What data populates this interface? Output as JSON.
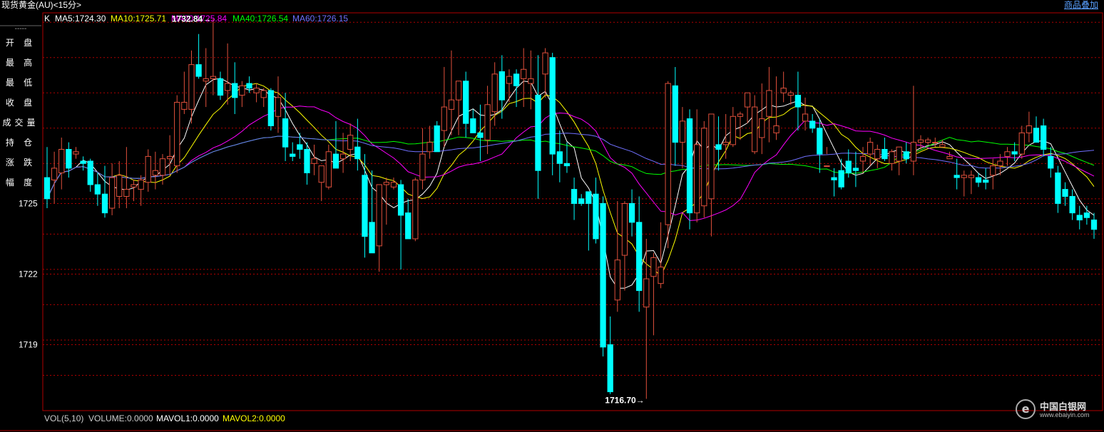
{
  "window": {
    "title": "现货黄金(AU)<15分>",
    "overlay_label": "商品叠加"
  },
  "sidebar": {
    "dash": "-----",
    "items": [
      "开 盘",
      "最 高",
      "最 低",
      "收 盘",
      "成交量",
      "持 仓",
      "涨 跌",
      "幅 度"
    ]
  },
  "logo": {
    "name": "中国白银网",
    "url": "www.ebaiyin.com"
  },
  "colors": {
    "up": "#e0503c",
    "down": "#00ffff",
    "ma5": "#ffffff",
    "ma10": "#ffff00",
    "ma20": "#ff00ff",
    "ma40": "#00ff00",
    "ma60": "#7070ff",
    "grid": "#b00000"
  },
  "legend": {
    "prefix": "K",
    "ma5": "MA5:1724.30",
    "ma10": "MA10:1725.71",
    "ma20": "MA20:1725.84",
    "ma40": "MA40:1726.54",
    "ma60": "MA60:1726.15"
  },
  "vol_legend": {
    "prefix": "VOL(5,10)",
    "volume": "VOLUME:0.0000",
    "mavol1": "MAVOL1:0.0000",
    "mavol2": "MAVOL2:0.0000"
  },
  "chart_data": {
    "type": "candlestick",
    "y_ticks": [
      1725,
      1722,
      1719
    ],
    "ylim": [
      1716.2,
      1733.1
    ],
    "grid": true,
    "annotations": {
      "high": "1732.84→",
      "low": "1716.70→"
    },
    "candles": [
      [
        1726.1,
        1727.4,
        1724.8,
        1725.2
      ],
      [
        1726.0,
        1727.2,
        1725.0,
        1726.5
      ],
      [
        1726.3,
        1727.8,
        1725.6,
        1727.3
      ],
      [
        1727.3,
        1727.6,
        1726.1,
        1726.5
      ],
      [
        1727.1,
        1727.4,
        1726.9,
        1727.2
      ],
      [
        1726.8,
        1727.0,
        1726.4,
        1726.7
      ],
      [
        1726.8,
        1726.9,
        1725.5,
        1725.8
      ],
      [
        1725.8,
        1726.3,
        1724.9,
        1725.4
      ],
      [
        1725.4,
        1726.6,
        1724.4,
        1724.6
      ],
      [
        1724.8,
        1726.7,
        1724.5,
        1726.1
      ],
      [
        1725.3,
        1726.8,
        1724.8,
        1726.2
      ],
      [
        1725.3,
        1727.4,
        1724.8,
        1725.6
      ],
      [
        1725.7,
        1726.0,
        1725.1,
        1725.8
      ],
      [
        1725.6,
        1726.2,
        1724.9,
        1726.0
      ],
      [
        1725.9,
        1727.3,
        1725.5,
        1727.0
      ],
      [
        1726.2,
        1727.2,
        1725.6,
        1726.4
      ],
      [
        1726.2,
        1727.1,
        1725.8,
        1726.9
      ],
      [
        1726.9,
        1727.9,
        1726.2,
        1727.0
      ],
      [
        1726.6,
        1729.6,
        1726.3,
        1729.3
      ],
      [
        1729.0,
        1730.6,
        1728.8,
        1729.3
      ],
      [
        1729.0,
        1731.5,
        1728.4,
        1730.9
      ],
      [
        1730.9,
        1732.2,
        1730.3,
        1730.4
      ],
      [
        1730.2,
        1731.6,
        1729.1,
        1730.3
      ],
      [
        1730.3,
        1732.84,
        1729.6,
        1730.4
      ],
      [
        1730.3,
        1730.6,
        1729.4,
        1729.6
      ],
      [
        1729.8,
        1731.8,
        1729.2,
        1730.1
      ],
      [
        1730.1,
        1731.0,
        1728.8,
        1729.5
      ],
      [
        1729.6,
        1730.2,
        1729.1,
        1730.0
      ],
      [
        1730.1,
        1730.4,
        1729.7,
        1729.9
      ],
      [
        1729.7,
        1730.1,
        1729.3,
        1729.9
      ],
      [
        1729.5,
        1729.9,
        1729.1,
        1729.8
      ],
      [
        1729.8,
        1729.9,
        1728.1,
        1728.3
      ],
      [
        1728.7,
        1730.4,
        1728.0,
        1729.5
      ],
      [
        1728.6,
        1729.7,
        1726.8,
        1727.4
      ],
      [
        1727.1,
        1727.6,
        1726.8,
        1727.0
      ],
      [
        1727.5,
        1728.0,
        1726.9,
        1727.3
      ],
      [
        1727.3,
        1727.6,
        1725.8,
        1726.3
      ],
      [
        1726.7,
        1727.5,
        1726.2,
        1726.9
      ],
      [
        1725.9,
        1726.6,
        1725.1,
        1726.6
      ],
      [
        1725.7,
        1727.5,
        1725.6,
        1727.2
      ],
      [
        1727.1,
        1728.5,
        1726.8,
        1726.5
      ],
      [
        1726.9,
        1728.0,
        1726.3,
        1727.1
      ],
      [
        1727.3,
        1728.4,
        1726.8,
        1727.9
      ],
      [
        1727.4,
        1728.6,
        1726.4,
        1726.9
      ],
      [
        1726.2,
        1727.1,
        1722.7,
        1723.6
      ],
      [
        1724.2,
        1726.4,
        1723.1,
        1722.9
      ],
      [
        1723.2,
        1725.8,
        1722.1,
        1725.8
      ],
      [
        1725.8,
        1726.1,
        1724.1,
        1725.9
      ],
      [
        1725.7,
        1726.1,
        1725.6,
        1725.9
      ],
      [
        1725.8,
        1726.0,
        1722.2,
        1724.5
      ],
      [
        1724.6,
        1725.2,
        1723.5,
        1723.5
      ],
      [
        1723.5,
        1726.1,
        1723.4,
        1726.0
      ],
      [
        1726.0,
        1728.2,
        1725.6,
        1727.1
      ],
      [
        1727.2,
        1728.3,
        1726.9,
        1727.6
      ],
      [
        1728.3,
        1728.5,
        1727.3,
        1727.2
      ],
      [
        1728.1,
        1730.8,
        1727.4,
        1729.1
      ],
      [
        1729.0,
        1731.5,
        1727.9,
        1729.4
      ],
      [
        1729.4,
        1730.1,
        1727.9,
        1730.2
      ],
      [
        1730.2,
        1730.6,
        1727.8,
        1728.4
      ],
      [
        1728.6,
        1729.0,
        1728.2,
        1728.0
      ],
      [
        1728.0,
        1729.2,
        1726.8,
        1727.8
      ],
      [
        1727.7,
        1730.0,
        1727.1,
        1729.2
      ],
      [
        1728.9,
        1731.0,
        1728.3,
        1730.5
      ],
      [
        1730.6,
        1731.3,
        1728.6,
        1729.4
      ],
      [
        1730.1,
        1730.7,
        1729.3,
        1730.4
      ],
      [
        1730.5,
        1730.7,
        1729.1,
        1730.0
      ],
      [
        1730.3,
        1731.6,
        1729.1,
        1730.7
      ],
      [
        1730.1,
        1731.5,
        1729.0,
        1730.3
      ],
      [
        1729.6,
        1731.3,
        1725.2,
        1726.4
      ],
      [
        1730.5,
        1731.6,
        1729.5,
        1731.4
      ],
      [
        1731.2,
        1731.4,
        1726.2,
        1727.1
      ],
      [
        1727.2,
        1728.1,
        1725.9,
        1726.7
      ],
      [
        1726.7,
        1727.6,
        1726.3,
        1726.6
      ],
      [
        1725.6,
        1726.1,
        1724.3,
        1725.0
      ],
      [
        1725.2,
        1725.4,
        1724.9,
        1725.0
      ],
      [
        1725.5,
        1725.5,
        1723.0,
        1725.0
      ],
      [
        1725.4,
        1726.1,
        1723.3,
        1723.5
      ],
      [
        1725.0,
        1725.3,
        1718.5,
        1718.9
      ],
      [
        1719.0,
        1720.2,
        1716.9,
        1717.0
      ],
      [
        1720.9,
        1725.1,
        1720.4,
        1722.6
      ],
      [
        1722.8,
        1725.1,
        1721.3,
        1725.0
      ],
      [
        1725.0,
        1725.6,
        1723.6,
        1724.2
      ],
      [
        1724.2,
        1725.3,
        1720.4,
        1721.3
      ],
      [
        1720.6,
        1723.5,
        1716.7,
        1721.8
      ],
      [
        1721.9,
        1722.9,
        1719.4,
        1722.7
      ],
      [
        1721.6,
        1724.2,
        1721.4,
        1722.3
      ],
      [
        1724.1,
        1730.2,
        1723.1,
        1730.1
      ],
      [
        1730.0,
        1730.8,
        1726.6,
        1727.6
      ],
      [
        1727.6,
        1729.1,
        1726.5,
        1728.5
      ],
      [
        1728.6,
        1729.0,
        1723.9,
        1724.6
      ],
      [
        1724.6,
        1729.0,
        1724.2,
        1727.5
      ],
      [
        1724.9,
        1728.5,
        1724.4,
        1728.2
      ],
      [
        1725.2,
        1728.4,
        1723.6,
        1728.8
      ],
      [
        1727.5,
        1728.7,
        1726.4,
        1727.3
      ],
      [
        1727.5,
        1728.8,
        1726.9,
        1727.6
      ],
      [
        1727.5,
        1729.1,
        1727.4,
        1728.7
      ],
      [
        1728.7,
        1728.9,
        1727.7,
        1728.8
      ],
      [
        1729.1,
        1729.4,
        1728.4,
        1729.7
      ],
      [
        1727.2,
        1729.6,
        1727.1,
        1729.1
      ],
      [
        1727.8,
        1730.1,
        1727.1,
        1728.6
      ],
      [
        1728.7,
        1730.8,
        1727.6,
        1729.8
      ],
      [
        1728.0,
        1730.4,
        1727.7,
        1728.3
      ],
      [
        1729.7,
        1730.6,
        1729.3,
        1729.9
      ],
      [
        1729.6,
        1729.8,
        1729.2,
        1729.7
      ],
      [
        1729.6,
        1730.6,
        1728.1,
        1729.1
      ],
      [
        1728.5,
        1729.5,
        1728.1,
        1728.8
      ],
      [
        1728.5,
        1728.8,
        1728.0,
        1728.2
      ],
      [
        1728.2,
        1728.6,
        1726.3,
        1727.1
      ],
      [
        1726.6,
        1727.4,
        1727.1,
        1726.6
      ],
      [
        1726.1,
        1726.5,
        1725.3,
        1726.0
      ],
      [
        1726.4,
        1726.9,
        1725.6,
        1725.7
      ],
      [
        1726.8,
        1727.3,
        1726.1,
        1726.3
      ],
      [
        1726.5,
        1727.2,
        1725.7,
        1726.4
      ],
      [
        1726.8,
        1727.4,
        1726.3,
        1727.0
      ],
      [
        1727.1,
        1727.8,
        1726.6,
        1727.6
      ],
      [
        1726.9,
        1727.5,
        1726.5,
        1727.3
      ],
      [
        1727.3,
        1727.8,
        1726.8,
        1726.9
      ],
      [
        1726.7,
        1727.3,
        1726.4,
        1727.2
      ],
      [
        1726.8,
        1727.4,
        1726.2,
        1727.4
      ],
      [
        1727.2,
        1727.6,
        1726.7,
        1726.9
      ],
      [
        1726.8,
        1730.0,
        1726.2,
        1727.6
      ],
      [
        1727.6,
        1727.9,
        1727.3,
        1727.7
      ],
      [
        1727.6,
        1727.8,
        1727.5,
        1727.7
      ],
      [
        1727.6,
        1727.8,
        1727.4,
        1727.6
      ],
      [
        1727.4,
        1727.7,
        1727.4,
        1727.5
      ],
      [
        1726.9,
        1727.2,
        1727.0,
        1727.0
      ],
      [
        1726.2,
        1726.9,
        1725.6,
        1726.1
      ],
      [
        1726.1,
        1726.4,
        1725.3,
        1726.2
      ],
      [
        1726.1,
        1726.4,
        1725.4,
        1726.2
      ],
      [
        1726.1,
        1726.3,
        1725.7,
        1725.9
      ],
      [
        1726.0,
        1726.5,
        1725.6,
        1725.9
      ],
      [
        1726.2,
        1726.9,
        1725.6,
        1726.6
      ],
      [
        1726.6,
        1727.1,
        1726.2,
        1726.8
      ],
      [
        1727.0,
        1727.4,
        1726.6,
        1727.2
      ],
      [
        1727.2,
        1727.6,
        1726.8,
        1727.1
      ],
      [
        1727.1,
        1728.3,
        1726.9,
        1728.0
      ],
      [
        1728.0,
        1728.9,
        1727.6,
        1728.3
      ],
      [
        1728.2,
        1728.7,
        1727.8,
        1727.6
      ],
      [
        1728.3,
        1728.6,
        1727.0,
        1727.3
      ],
      [
        1727.0,
        1727.4,
        1726.1,
        1726.5
      ],
      [
        1726.3,
        1726.6,
        1724.6,
        1725.0
      ],
      [
        1725.6,
        1725.9,
        1724.9,
        1725.3
      ],
      [
        1725.3,
        1725.6,
        1724.3,
        1724.6
      ],
      [
        1724.5,
        1724.9,
        1723.9,
        1724.3
      ],
      [
        1724.6,
        1724.9,
        1724.1,
        1724.4
      ],
      [
        1724.3,
        1724.6,
        1723.5,
        1723.9
      ]
    ]
  }
}
